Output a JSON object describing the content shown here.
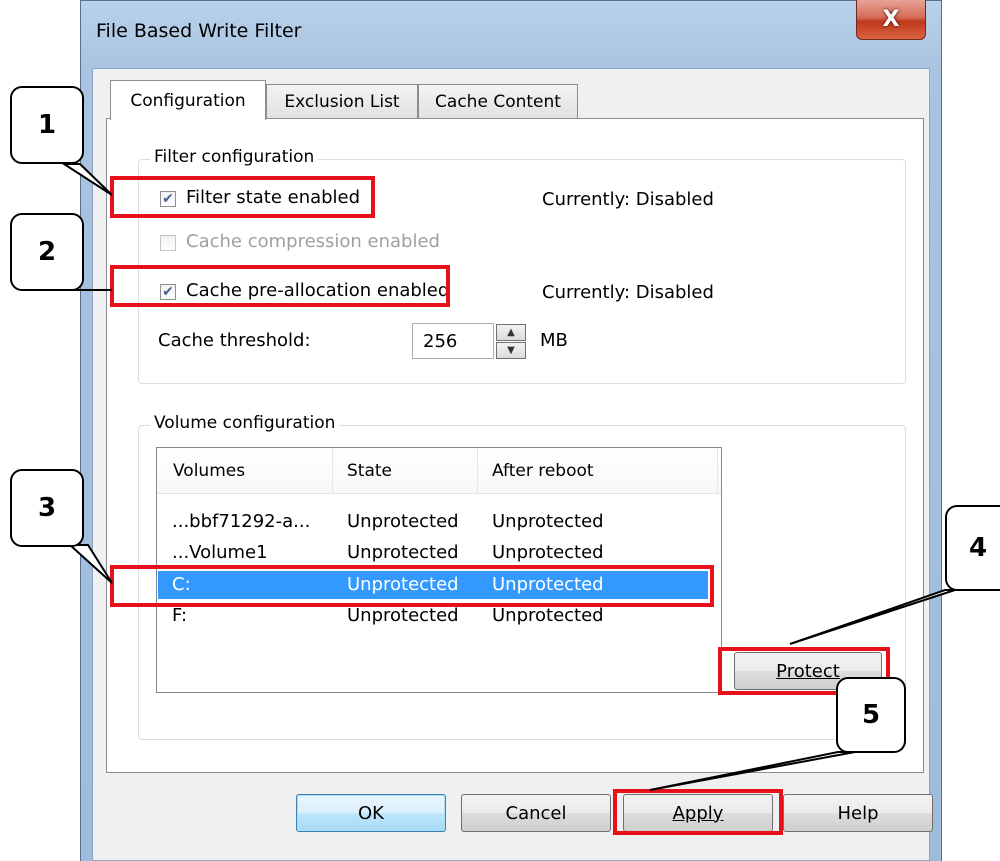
{
  "window": {
    "title": "File Based Write Filter",
    "close_glyph": "X"
  },
  "tabs": [
    {
      "label": "Configuration",
      "active": true
    },
    {
      "label": "Exclusion List",
      "active": false
    },
    {
      "label": "Cache Content",
      "active": false
    }
  ],
  "filter_config": {
    "group_label": "Filter configuration",
    "filter_state": {
      "label": "Filter state enabled",
      "checked": true,
      "status": "Currently: Disabled"
    },
    "cache_compression": {
      "label": "Cache compression enabled",
      "checked": false,
      "disabled": true
    },
    "cache_prealloc": {
      "label": "Cache pre-allocation enabled",
      "checked": true,
      "status": "Currently: Disabled"
    },
    "threshold": {
      "label": "Cache threshold:",
      "value": "256",
      "unit": "MB"
    }
  },
  "volume_config": {
    "group_label": "Volume configuration",
    "columns": [
      "Volumes",
      "State",
      "After reboot"
    ],
    "rows": [
      {
        "volume": "...bbf71292-a...",
        "state": "Unprotected",
        "after": "Unprotected",
        "selected": false
      },
      {
        "volume": "...Volume1",
        "state": "Unprotected",
        "after": "Unprotected",
        "selected": false
      },
      {
        "volume": "C:",
        "state": "Unprotected",
        "after": "Unprotected",
        "selected": true
      },
      {
        "volume": "F:",
        "state": "Unprotected",
        "after": "Unprotected",
        "selected": false
      }
    ],
    "protect_label": "Protect"
  },
  "buttons": {
    "ok": "OK",
    "cancel": "Cancel",
    "apply": "Apply",
    "help": "Help"
  },
  "callouts": [
    "1",
    "2",
    "3",
    "4",
    "5"
  ],
  "colors": {
    "highlight": "#e8101a",
    "selection": "#3399ff"
  }
}
